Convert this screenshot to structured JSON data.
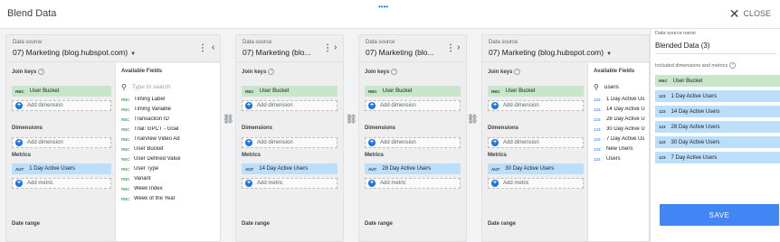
{
  "window": {
    "title": "Blend Data",
    "dots": "••••",
    "close_label": "CLOSE"
  },
  "labels": {
    "data_source": "Data source",
    "join_keys": "Join keys",
    "dimensions": "Dimensions",
    "metrics": "Metrics",
    "date_range": "Date range",
    "add_dimension": "Add dimension",
    "add_metric": "Add metric",
    "available_fields": "Available Fields",
    "help": "?",
    "plus": "+",
    "kebab": "⋮",
    "caret": "▼",
    "search_icon": "search-icon",
    "link_icon": "link-icon"
  },
  "tags": {
    "rbc": "RBC",
    "aut": "AUT",
    "num": "123"
  },
  "sources": [
    {
      "name": "07) Marketing (blog.hubspot.com)",
      "chevron": "‹",
      "join_key": "User Bucket",
      "metric": "1 Day Active Users",
      "fields": {
        "placeholder": "Type to search",
        "items": [
          "Timing Label",
          "Timing Variable",
          "Transaction ID",
          "Trial: GPCT - Goal",
          "TrueView Video Ad",
          "User Bucket",
          "User Defined Value",
          "User Type",
          "Variant",
          "Week Index",
          "Week of the Year"
        ]
      }
    },
    {
      "name": "07) Marketing (blo...",
      "chevron": "›",
      "join_key": "User Bucket",
      "metric": "14 Day Active Users"
    },
    {
      "name": "07) Marketing (blo...",
      "chevron": "›",
      "join_key": "User Bucket",
      "metric": "28 Day Active Users"
    },
    {
      "name": "07) Marketing (blog.hubspot.com)",
      "join_key": "User Bucket",
      "metric": "30 Day Active Users",
      "fields": {
        "search_value": "users",
        "items": [
          "1 Day Active Us",
          "14 Day Active U",
          "28 Day Active U",
          "30 Day Active U",
          "7 Day Active Us",
          "New Users",
          "Users"
        ]
      }
    }
  ],
  "right_panel": {
    "name_label": "Data source name",
    "name_value": "Blended Data (3)",
    "included_label": "Included dimensions and metrics",
    "dimension": "User Bucket",
    "metrics": [
      "1 Day Active Users",
      "14 Day Active Users",
      "28 Day Active Users",
      "30 Day Active Users",
      "7 Day Active Users"
    ],
    "save_label": "SAVE"
  },
  "colors": {
    "dimension_chip": "#c8e6c9",
    "metric_chip": "#bbdefb",
    "accent": "#4285f4"
  }
}
